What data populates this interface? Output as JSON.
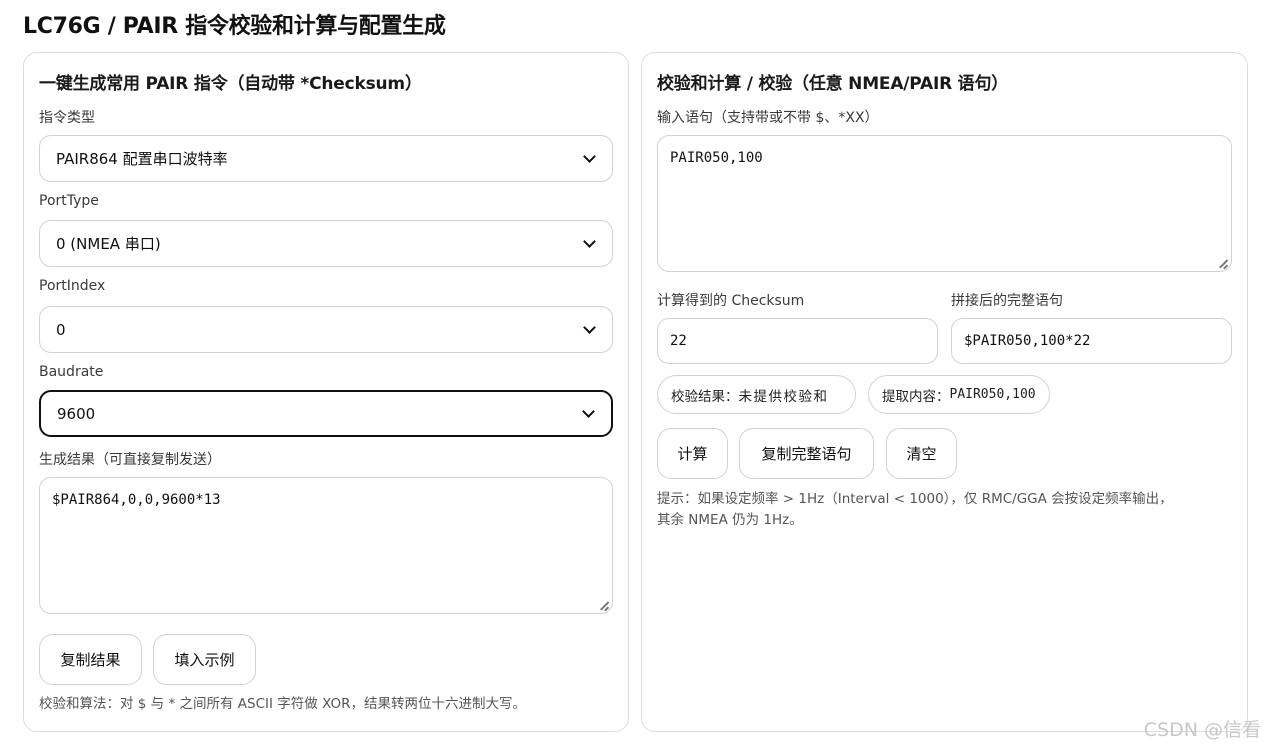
{
  "page": {
    "title": "LC76G / PAIR 指令校验和计算与配置生成"
  },
  "left": {
    "heading": "一键生成常用 PAIR 指令（自动带 *Checksum）",
    "command_type": {
      "label": "指令类型",
      "value": "PAIR864 配置串口波特率"
    },
    "port_type": {
      "label": "PortType",
      "value": "0 (NMEA 串口)"
    },
    "port_index": {
      "label": "PortIndex",
      "value": "0"
    },
    "baudrate": {
      "label": "Baudrate",
      "value": "9600"
    },
    "result": {
      "label": "生成结果（可直接复制发送）",
      "value": "$PAIR864,0,0,9600*13"
    },
    "buttons": {
      "copy": "复制结果",
      "example": "填入示例"
    },
    "footnote": "校验和算法：对 $ 与 * 之间所有 ASCII 字符做 XOR，结果转两位十六进制大写。"
  },
  "right": {
    "heading": "校验和计算 / 校验（任意 NMEA/PAIR 语句）",
    "input": {
      "label": "输入语句（支持带或不带 $、*XX）",
      "value": "PAIR050,100"
    },
    "checksum": {
      "label": "计算得到的 Checksum",
      "value": "22"
    },
    "full": {
      "label": "拼接后的完整语句",
      "value": "$PAIR050,100*22"
    },
    "verify_pill": {
      "prefix": "校验结果：",
      "value": "未提供校验和"
    },
    "extract_pill": {
      "prefix": "提取内容：",
      "value": "PAIR050,100"
    },
    "buttons": {
      "compute": "计算",
      "copy_full": "复制完整语句",
      "clear": "清空"
    },
    "hint_line1": "提示：如果设定频率 > 1Hz（Interval < 1000），仅 RMC/GGA 会按设定频率输出，",
    "hint_line2": "其余 NMEA 仍为 1Hz。"
  },
  "watermark": "CSDN @信看"
}
